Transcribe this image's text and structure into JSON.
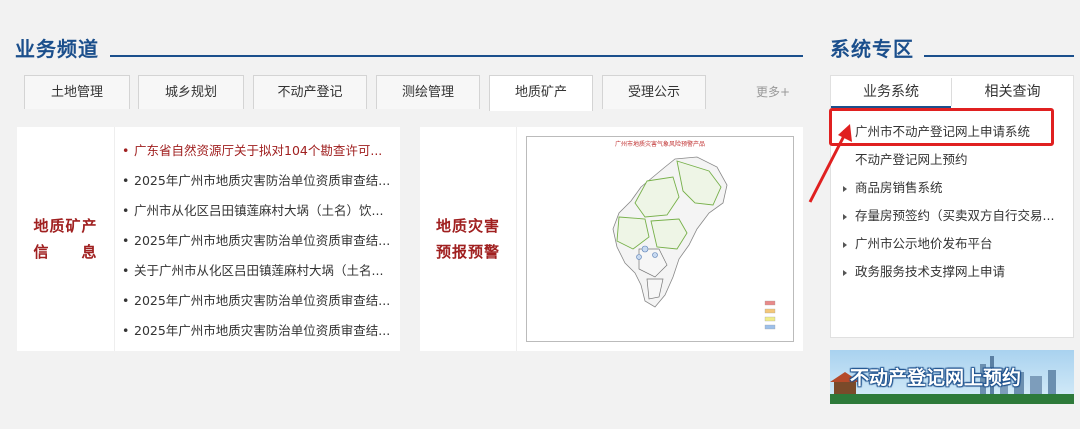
{
  "business": {
    "title": "业务频道",
    "tabs": [
      "土地管理",
      "城乡规划",
      "不动产登记",
      "测绘管理",
      "地质矿产",
      "受理公示"
    ],
    "active_tab": 4,
    "more": "更多+"
  },
  "geo_info": {
    "label_line1": "地质矿产",
    "label_line2": "信　　息",
    "items": [
      "广东省自然资源厅关于拟对104个勘查许可...",
      "2025年广州市地质灾害防治单位资质审查结...",
      "广州市从化区吕田镇莲麻村大埚（土名）饮...",
      "2025年广州市地质灾害防治单位资质审查结...",
      "关于广州市从化区吕田镇莲麻村大埚（土名...",
      "2025年广州市地质灾害防治单位资质审查结...",
      "2025年广州市地质灾害防治单位资质审查结..."
    ]
  },
  "warning": {
    "label_line1": "地质灾害",
    "label_line2": "预报预警",
    "map_title": "广州市地质灾害气象风险预警产品"
  },
  "system": {
    "title": "系统专区",
    "tabs": [
      "业务系统",
      "相关查询"
    ],
    "items": [
      "广州市不动产登记网上申请系统",
      "不动产登记网上预约",
      "商品房销售系统",
      "存量房预签约（买卖双方自行交易...",
      "广州市公示地价发布平台",
      "政务服务技术支撑网上申请"
    ],
    "banner_text": "不动产登记网上预约"
  },
  "colors": {
    "brand_blue": "#1b4f8c",
    "accent_red": "#a02020",
    "highlight_red": "#e02020"
  }
}
